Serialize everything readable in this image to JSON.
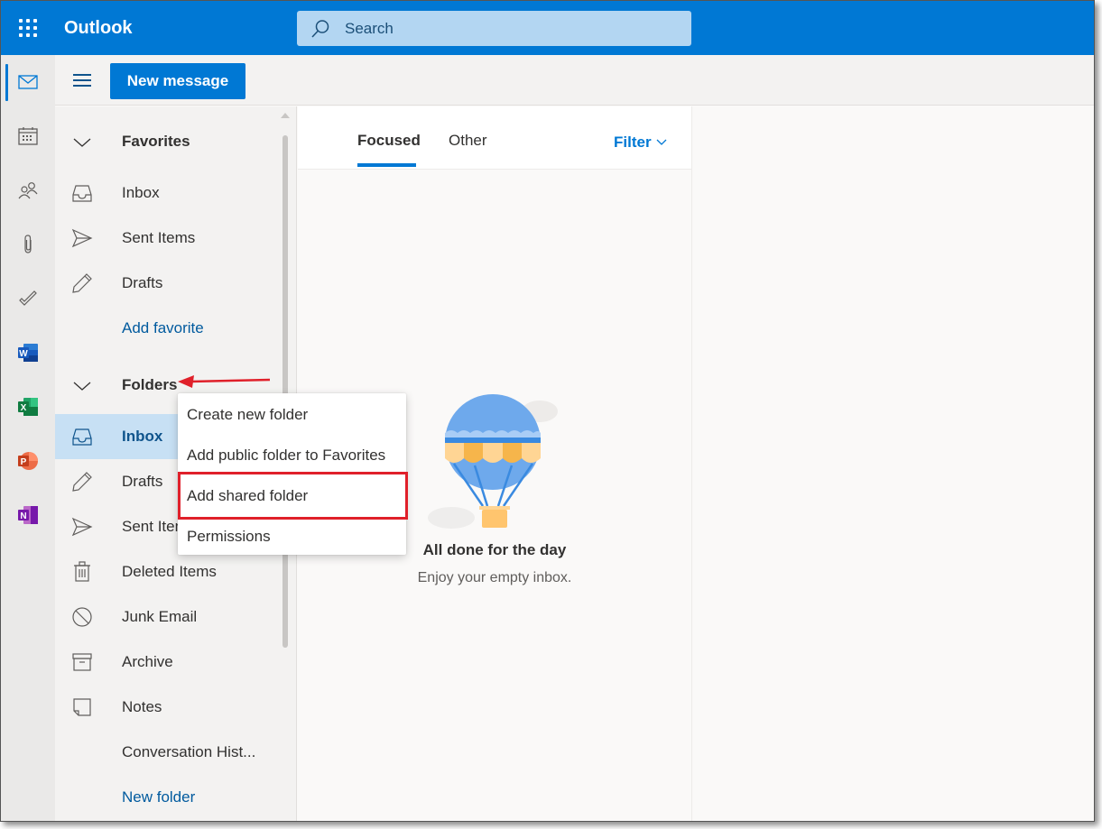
{
  "header": {
    "app_launcher_icon": "waffle-icon",
    "app_title": "Outlook",
    "search": {
      "placeholder": "Search",
      "icon": "search-icon"
    },
    "brand_color": "#0078d4"
  },
  "rail": {
    "items": [
      {
        "name": "Mail",
        "icon": "mail-icon",
        "active": true
      },
      {
        "name": "Calendar",
        "icon": "calendar-icon"
      },
      {
        "name": "People",
        "icon": "people-icon"
      },
      {
        "name": "Files",
        "icon": "paperclip-icon"
      },
      {
        "name": "To Do",
        "icon": "checkmark-icon"
      },
      {
        "name": "Word",
        "icon": "word-icon",
        "letter": "W",
        "color": "#185abd"
      },
      {
        "name": "Excel",
        "icon": "excel-icon",
        "letter": "X",
        "color": "#107c41"
      },
      {
        "name": "PowerPoint",
        "icon": "powerpoint-icon",
        "letter": "P",
        "color": "#c43e1c"
      },
      {
        "name": "OneNote",
        "icon": "onenote-icon",
        "letter": "N",
        "color": "#7719aa"
      }
    ]
  },
  "command_bar": {
    "menu_icon": "hamburger-icon",
    "new_message_label": "New message"
  },
  "folder_pane": {
    "favorites": {
      "header": "Favorites",
      "items": [
        {
          "label": "Inbox",
          "icon": "inbox-icon"
        },
        {
          "label": "Sent Items",
          "icon": "send-icon"
        },
        {
          "label": "Drafts",
          "icon": "pencil-icon"
        }
      ],
      "add_link": "Add favorite"
    },
    "folders": {
      "header": "Folders",
      "items": [
        {
          "label": "Inbox",
          "icon": "inbox-icon",
          "selected": true
        },
        {
          "label": "Drafts",
          "icon": "pencil-icon"
        },
        {
          "label": "Sent Items",
          "icon": "send-icon"
        },
        {
          "label": "Deleted Items",
          "icon": "trash-icon"
        },
        {
          "label": "Junk Email",
          "icon": "blocked-icon"
        },
        {
          "label": "Archive",
          "icon": "archive-icon"
        },
        {
          "label": "Notes",
          "icon": "note-icon"
        },
        {
          "label": "Conversation Hist...",
          "icon": ""
        }
      ],
      "new_folder_link": "New folder"
    }
  },
  "context_menu": {
    "items": [
      {
        "label": "Create new folder"
      },
      {
        "label": "Add public folder to Favorites"
      },
      {
        "label": "Add shared folder",
        "highlighted": true
      },
      {
        "label": "Permissions"
      }
    ],
    "highlight_color": "#e0202a"
  },
  "message_list": {
    "tabs": [
      {
        "label": "Focused",
        "active": true
      },
      {
        "label": "Other",
        "active": false
      }
    ],
    "filter_label": "Filter",
    "empty_state": {
      "illustration": "hot-air-balloon",
      "title": "All done for the day",
      "subtitle": "Enjoy your empty inbox."
    }
  }
}
